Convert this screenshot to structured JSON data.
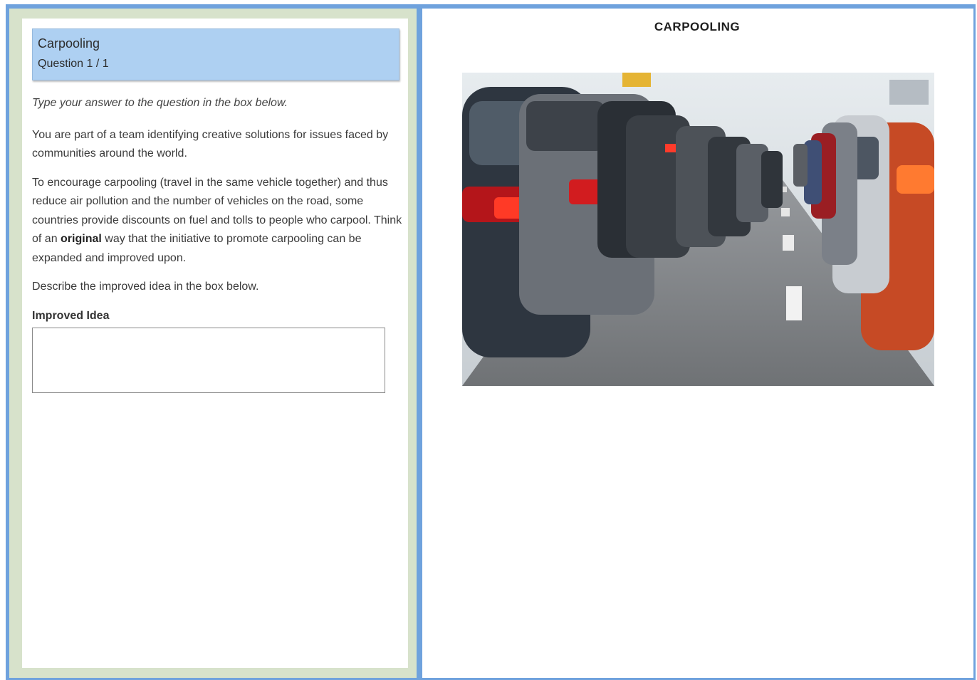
{
  "header": {
    "title": "Carpooling",
    "question_counter": "Question 1 / 1"
  },
  "body": {
    "instruction": "Type your answer to the question in the box below.",
    "intro": "You are part of a team identifying creative solutions for issues faced by communities around the world.",
    "prompt_before": "To encourage carpooling (travel in the same vehicle together) and thus reduce air pollution and the number of vehicles on the road, some countries provide discounts on fuel and tolls to people who carpool. Think of an ",
    "prompt_bold": "original",
    "prompt_after": " way that the initiative to promote carpooling can be expanded and improved upon.",
    "task": "Describe the improved idea in the box below.",
    "answer_label": "Improved Idea",
    "answer_value": ""
  },
  "stimulus": {
    "title": "CARPOOLING",
    "image_subject": "traffic-jam-photo"
  },
  "colors": {
    "frame_blue": "#6fa2dd",
    "left_pane_bg": "#d7e2cb",
    "header_bg": "#aed0f2"
  }
}
